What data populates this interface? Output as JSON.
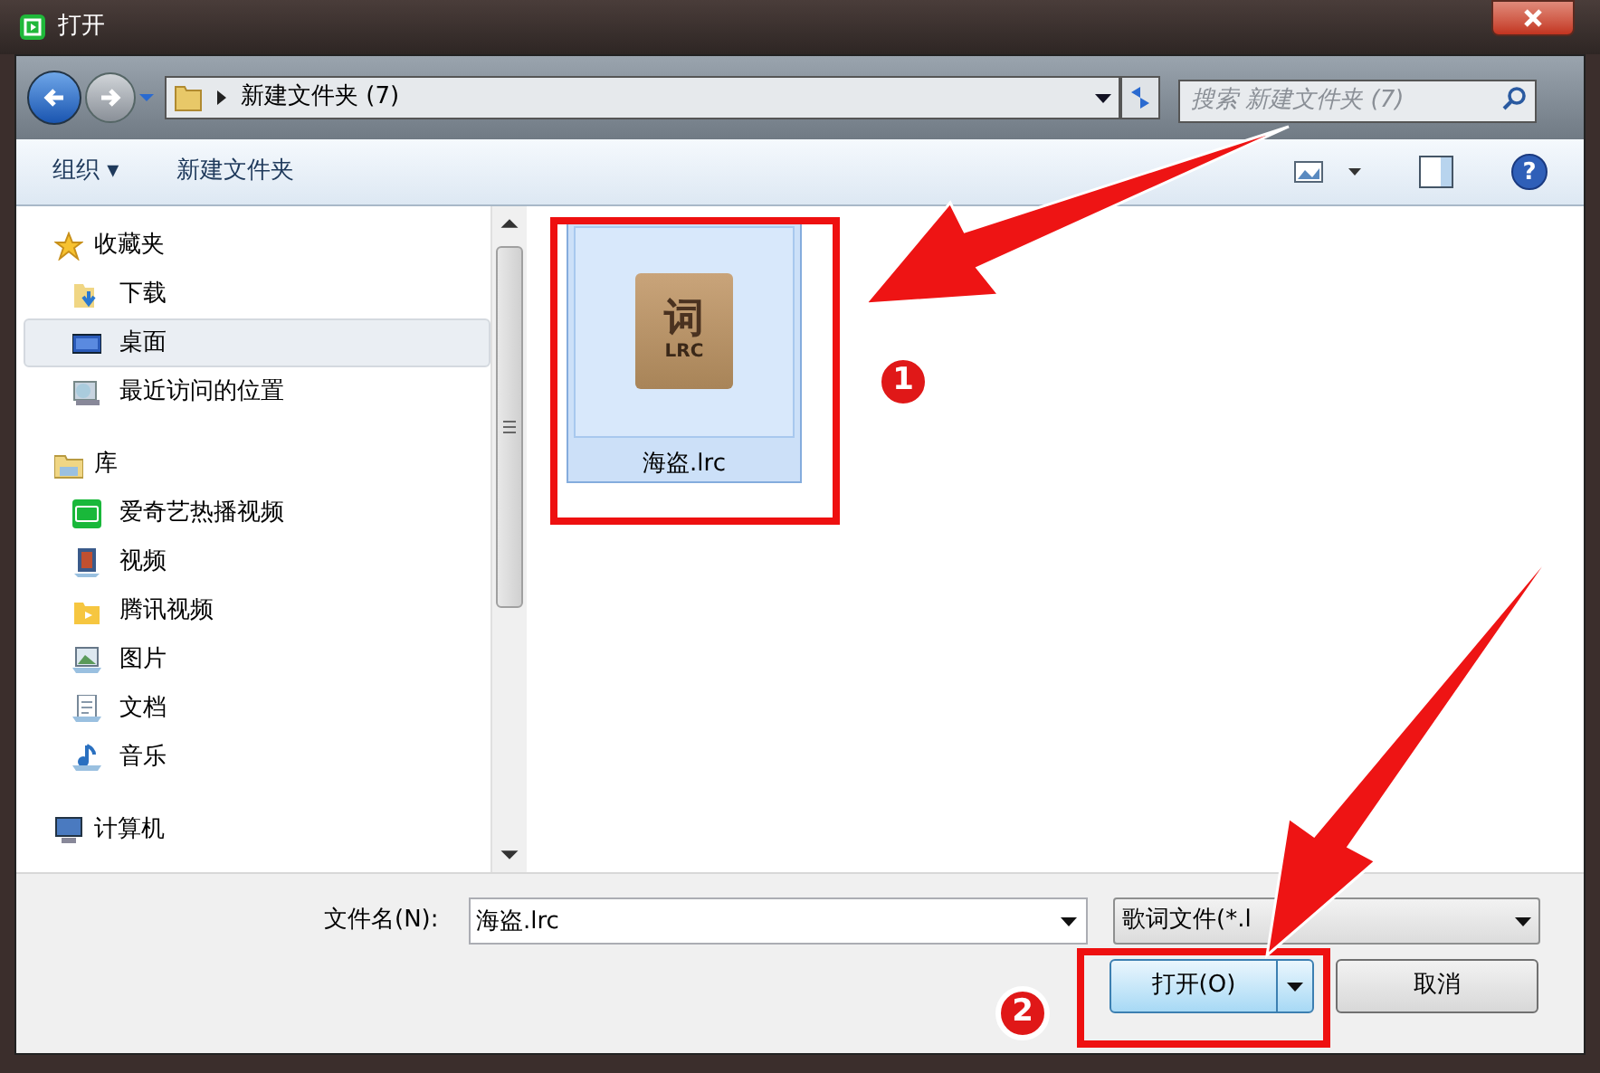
{
  "window": {
    "title": "打开"
  },
  "address": {
    "path": "新建文件夹 (7)",
    "search_placeholder": "搜索 新建文件夹 (7)"
  },
  "toolbar": {
    "organize": "组织 ▾",
    "new_folder": "新建文件夹",
    "help": "?"
  },
  "sidebar": {
    "items": [
      {
        "label": "收藏夹",
        "selected": false,
        "children": [
          {
            "label": "下载",
            "selected": false
          },
          {
            "label": "桌面",
            "selected": true
          },
          {
            "label": "最近访问的位置",
            "selected": false
          }
        ]
      },
      {
        "label": "库",
        "selected": false,
        "children": [
          {
            "label": "爱奇艺热播视频",
            "selected": false
          },
          {
            "label": "视频",
            "selected": false
          },
          {
            "label": "腾讯视频",
            "selected": false
          },
          {
            "label": "图片",
            "selected": false
          },
          {
            "label": "文档",
            "selected": false
          },
          {
            "label": "音乐",
            "selected": false
          }
        ]
      },
      {
        "label": "计算机",
        "selected": false
      }
    ]
  },
  "files": [
    {
      "name": "海盗.lrc",
      "icon_text": [
        "词",
        "LRC"
      ],
      "selected": true
    }
  ],
  "bottom": {
    "filename_label": "文件名(N):",
    "filename": "海盗.lrc",
    "filetype": "歌词文件(*.l",
    "open_button": "打开(O)",
    "cancel_button": "取消"
  },
  "annotations": [
    {
      "label": "1"
    },
    {
      "label": "2"
    }
  ]
}
